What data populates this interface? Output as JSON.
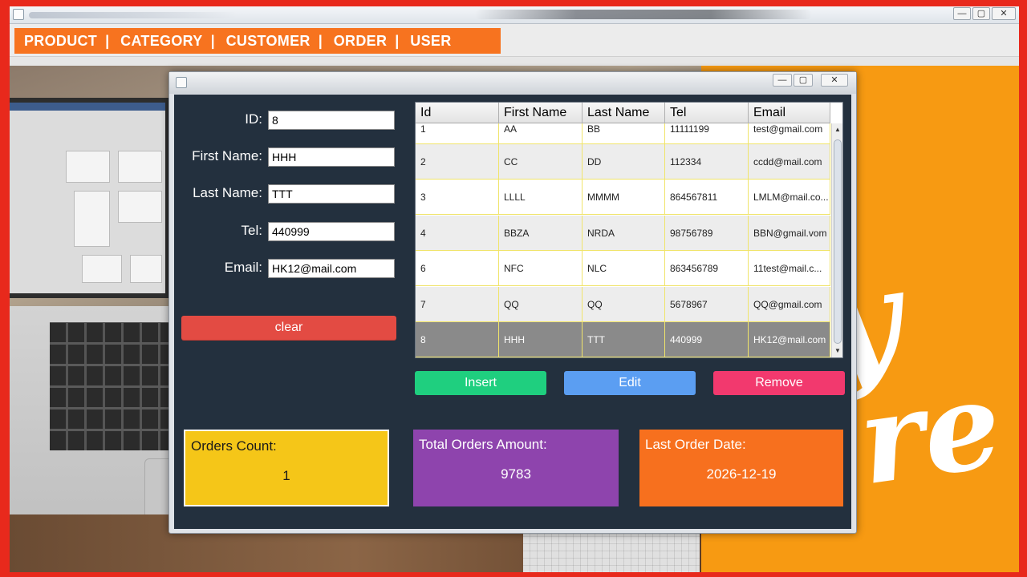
{
  "menu": {
    "items": [
      "PRODUCT",
      "CATEGORY",
      "CUSTOMER",
      "ORDER",
      "USER"
    ],
    "separator": "|",
    "color": "#f7731f"
  },
  "window_controls": {
    "minimize": "—",
    "maximize": "▢",
    "close": "✕"
  },
  "form": {
    "labels": {
      "id": "ID:",
      "first_name": "First Name:",
      "last_name": "Last Name:",
      "tel": "Tel:",
      "email": "Email:"
    },
    "values": {
      "id": "8",
      "first_name": "HHH",
      "last_name": "TTT",
      "tel": "440999",
      "email": "HK12@mail.com"
    },
    "clear_label": "clear"
  },
  "table": {
    "columns": [
      "Id",
      "First Name",
      "Last Name",
      "Tel",
      "Email"
    ],
    "rows": [
      [
        "1",
        "AA",
        "BB",
        "11111199",
        "test@gmail.com"
      ],
      [
        "2",
        "CC",
        "DD",
        "112334",
        "ccdd@mail.com"
      ],
      [
        "3",
        "LLLL",
        "MMMM",
        "864567811",
        "LMLM@mail.co..."
      ],
      [
        "4",
        "BBZA",
        "NRDA",
        "98756789",
        "BBN@gmail.vom"
      ],
      [
        "6",
        "NFC",
        "NLC",
        "863456789",
        "11test@mail.c..."
      ],
      [
        "7",
        "QQ",
        "QQ",
        "5678967",
        "QQ@gmail.com"
      ],
      [
        "8",
        "HHH",
        "TTT",
        "440999",
        "HK12@mail.com"
      ]
    ],
    "selected_row": 6
  },
  "actions": {
    "insert": "Insert",
    "edit": "Edit",
    "remove": "Remove",
    "colors": {
      "insert": "#1fcf7f",
      "edit": "#5b9ef2",
      "remove": "#f2396e",
      "clear": "#e34b43"
    }
  },
  "stats": {
    "orders_count": {
      "title": "Orders Count:",
      "value": "1",
      "color": "#f5c618"
    },
    "total_amount": {
      "title": "Total Orders Amount:",
      "value": "9783",
      "color": "#8e44ad"
    },
    "last_order_date": {
      "title": "Last Order Date:",
      "value": "2026-12-19",
      "color": "#f7701e"
    }
  },
  "icons": {
    "app": "java-app-icon",
    "scroll_up": "▲",
    "scroll_down": "▼"
  }
}
